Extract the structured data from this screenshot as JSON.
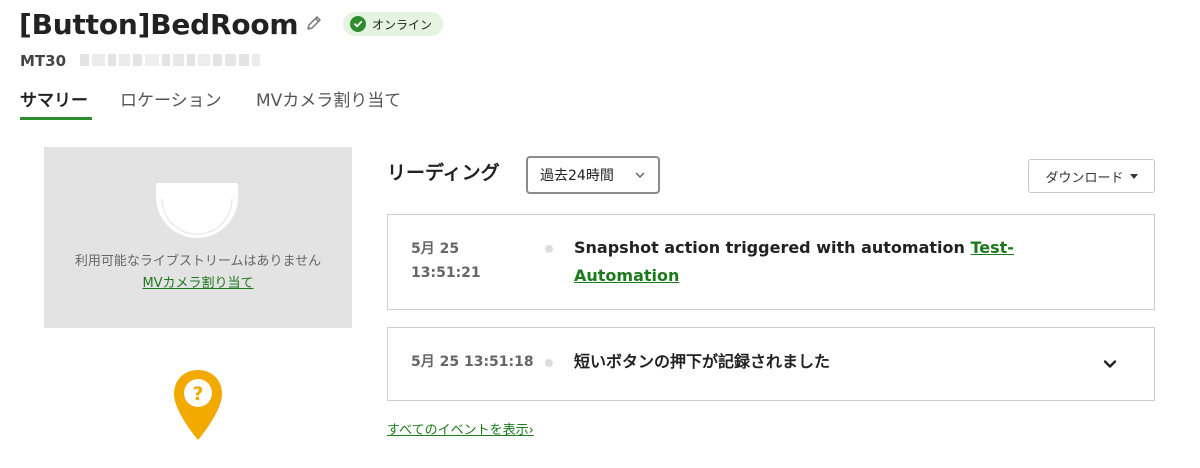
{
  "header": {
    "title": "[Button]BedRoom",
    "status": "オンライン",
    "model": "MT30",
    "edit_icon": "pencil-icon",
    "status_icon": "check-circle-icon",
    "status_color": "#2e8b2e"
  },
  "tabs": [
    {
      "label": "サマリー",
      "active": true
    },
    {
      "label": "ロケーション",
      "active": false
    },
    {
      "label": "MVカメラ割り当て",
      "active": false
    }
  ],
  "camera": {
    "icon": "dome-camera-icon",
    "no_stream_text": "利用可能なライブストリームはありません",
    "assign_link": "MVカメラ割り当て"
  },
  "location": {
    "icon": "unknown-location-pin-icon",
    "pin_color": "#f2a900"
  },
  "readings": {
    "title": "リーディング",
    "period": "過去24時間",
    "download_label": "ダウンロード",
    "events": [
      {
        "date": "5月 25",
        "time": "13:51:21",
        "text": "Snapshot action triggered with automation",
        "link": "Test-Automation"
      },
      {
        "datetime": "5月 25 13:51:18",
        "text": "短いボタンの押下が記録されました"
      }
    ],
    "all_events_link": "すべてのイベントを表示›"
  },
  "colors": {
    "accent_green": "#2e8b2e",
    "link_green": "#1c7a1c",
    "badge_bg": "#e4f4e1",
    "panel_gray": "#e3e3e3"
  }
}
